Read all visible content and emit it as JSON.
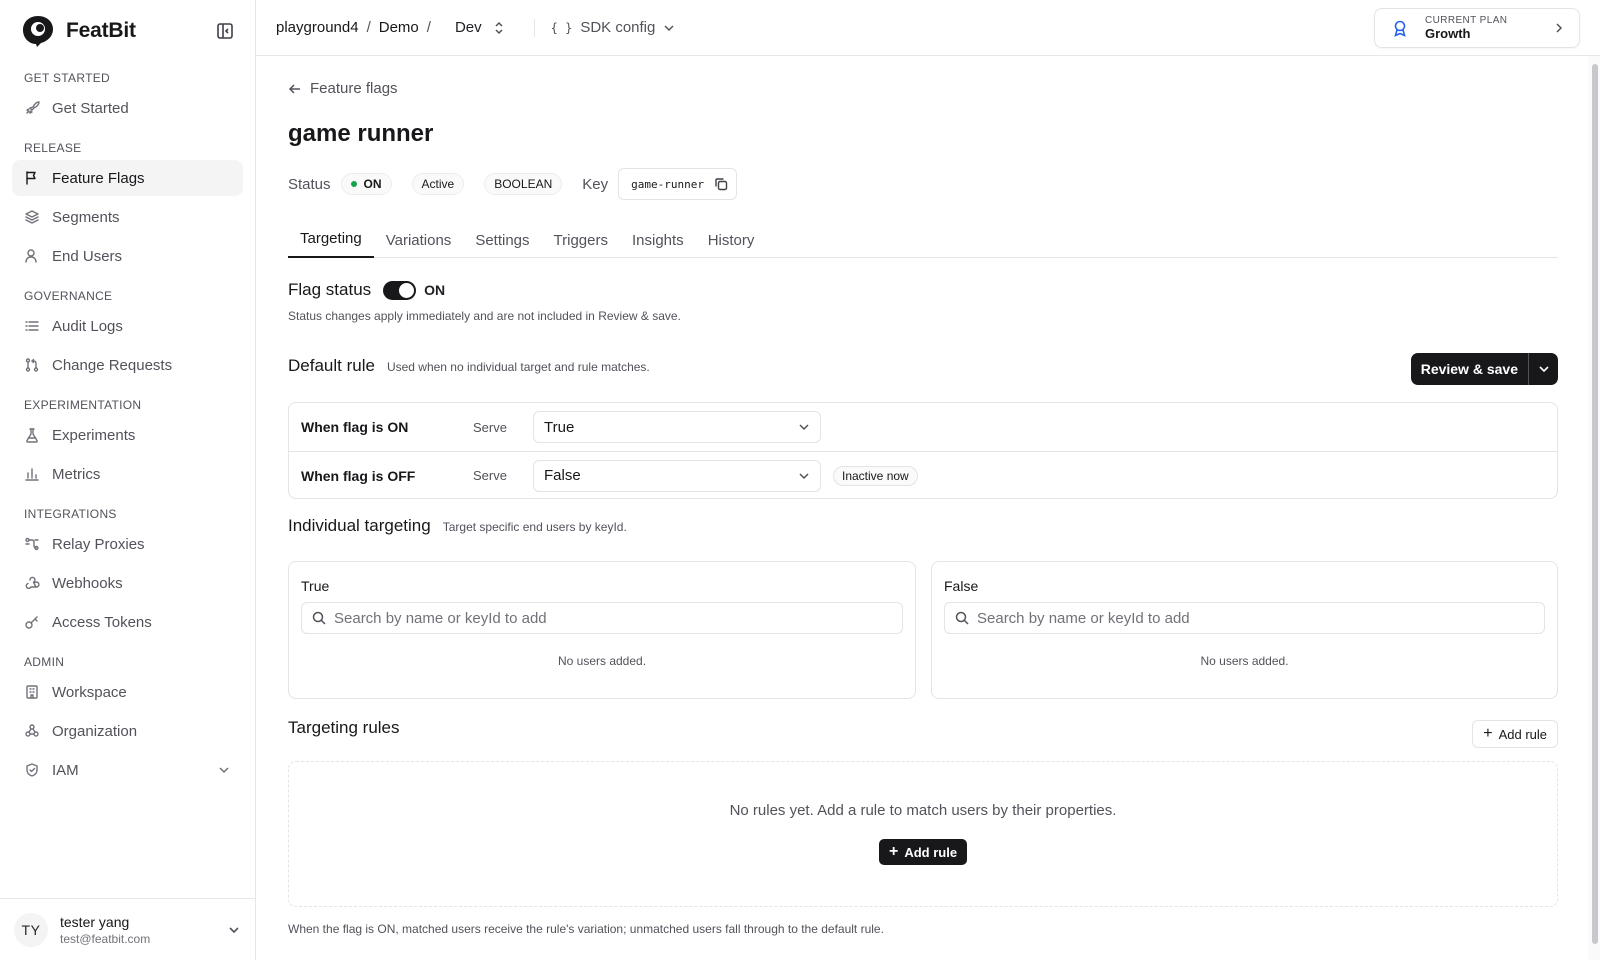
{
  "app": {
    "name": "FeatBit"
  },
  "sidebar": {
    "sections": [
      {
        "title": "GET STARTED",
        "items": [
          {
            "label": "Get Started",
            "icon": "rocket-icon"
          }
        ]
      },
      {
        "title": "RELEASE",
        "items": [
          {
            "label": "Feature Flags",
            "icon": "flag-icon",
            "active": true
          },
          {
            "label": "Segments",
            "icon": "layers-icon"
          },
          {
            "label": "End Users",
            "icon": "user-icon"
          }
        ]
      },
      {
        "title": "GOVERNANCE",
        "items": [
          {
            "label": "Audit Logs",
            "icon": "list-icon"
          },
          {
            "label": "Change Requests",
            "icon": "git-pull-request-icon"
          }
        ]
      },
      {
        "title": "EXPERIMENTATION",
        "items": [
          {
            "label": "Experiments",
            "icon": "flask-icon"
          },
          {
            "label": "Metrics",
            "icon": "bar-chart-icon"
          }
        ]
      },
      {
        "title": "INTEGRATIONS",
        "items": [
          {
            "label": "Relay Proxies",
            "icon": "relay-icon"
          },
          {
            "label": "Webhooks",
            "icon": "webhook-icon"
          },
          {
            "label": "Access Tokens",
            "icon": "key-icon"
          }
        ]
      },
      {
        "title": "ADMIN",
        "items": [
          {
            "label": "Workspace",
            "icon": "building-icon"
          },
          {
            "label": "Organization",
            "icon": "organization-icon"
          },
          {
            "label": "IAM",
            "icon": "shield-icon",
            "expandable": true
          }
        ]
      }
    ]
  },
  "user": {
    "initials": "TY",
    "name": "tester yang",
    "email": "test@featbit.com"
  },
  "topbar": {
    "breadcrumb": [
      "playground4",
      "Demo"
    ],
    "env": "Dev",
    "sdk_braces": "{ }",
    "sdk_config": "SDK config",
    "plan_label": "CURRENT PLAN",
    "plan_value": "Growth"
  },
  "flag": {
    "back_label": "Feature flags",
    "name": "game runner",
    "status_label": "Status",
    "status_value": "ON",
    "state": "Active",
    "type": "BOOLEAN",
    "key_label": "Key",
    "key": "game-runner"
  },
  "tabs": [
    "Targeting",
    "Variations",
    "Settings",
    "Triggers",
    "Insights",
    "History"
  ],
  "active_tab": "Targeting",
  "flag_status": {
    "title": "Flag status",
    "toggle_label": "ON",
    "toggle_on": true,
    "note": "Status changes apply immediately and are not included in Review & save."
  },
  "default_rule": {
    "title": "Default rule",
    "note": "Used when no individual target and rule matches.",
    "review_label": "Review & save",
    "rows": [
      {
        "label": "When flag is ON",
        "serve": "Serve",
        "value": "True"
      },
      {
        "label": "When flag is OFF",
        "serve": "Serve",
        "value": "False",
        "badge": "Inactive now"
      }
    ]
  },
  "individual": {
    "title": "Individual targeting",
    "note": "Target specific end users by keyId.",
    "cards": [
      {
        "title": "True",
        "placeholder": "Search by name or keyId to add",
        "empty": "No users added."
      },
      {
        "title": "False",
        "placeholder": "Search by name or keyId to add",
        "empty": "No users added."
      }
    ]
  },
  "targeting_rules": {
    "title": "Targeting rules",
    "add_label": "Add rule",
    "empty": "No rules yet. Add a rule to match users by their properties.",
    "add_solid_label": "Add rule",
    "footnote": "When the flag is ON, matched users receive the rule's variation; unmatched users fall through to the default rule."
  }
}
